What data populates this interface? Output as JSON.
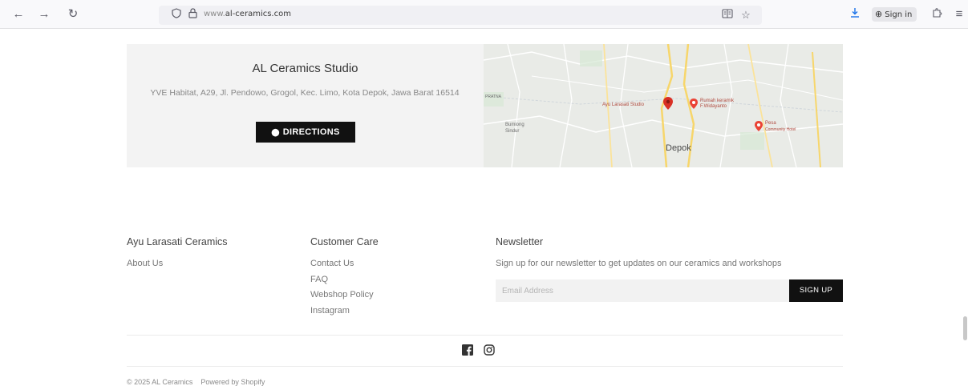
{
  "browser": {
    "url_prefix": "www.",
    "url_host": "al-ceramics.com",
    "signin_label": "Sign in",
    "icons": [
      "back-arrow-icon",
      "forward-arrow-icon",
      "reload-icon",
      "shield-icon",
      "lock-icon",
      "reader-view-icon",
      "bookmark-star-icon",
      "download-icon",
      "account-icon",
      "extensions-icon",
      "menu-icon"
    ]
  },
  "store": {
    "name": "AL Ceramics Studio",
    "address": "YVE Habitat, A29, Jl. Pendowo, Grogol, Kec. Limo, Kota Depok, Jawa Barat 16514",
    "directions_label": "DIRECTIONS"
  },
  "map": {
    "marker_main_label": "Ayu Larasati Studio",
    "marker2_label": "Rumah keramik F.Widayanto",
    "marker3_label": "Pesa",
    "marker3_sub": "Community Hotel",
    "city_label": "Depok",
    "area_label": "Bumiong",
    "area_sub": "Sindur",
    "west_label": "PRATNA",
    "accent": "#d93025"
  },
  "footer": {
    "col1": {
      "title": "Ayu Larasati Ceramics",
      "links": [
        "About Us"
      ]
    },
    "col2": {
      "title": "Customer Care",
      "links": [
        "Contact Us",
        "FAQ",
        "Webshop Policy",
        "Instagram"
      ]
    },
    "newsletter": {
      "title": "Newsletter",
      "text": "Sign up for our newsletter to get updates on our ceramics and workshops",
      "email_placeholder": "Email Address",
      "signup_label": "SIGN UP"
    },
    "social_icons": [
      "facebook-icon",
      "instagram-icon"
    ],
    "copyright": "© 2025 AL Ceramics",
    "powered_by": "Powered by Shopify"
  }
}
